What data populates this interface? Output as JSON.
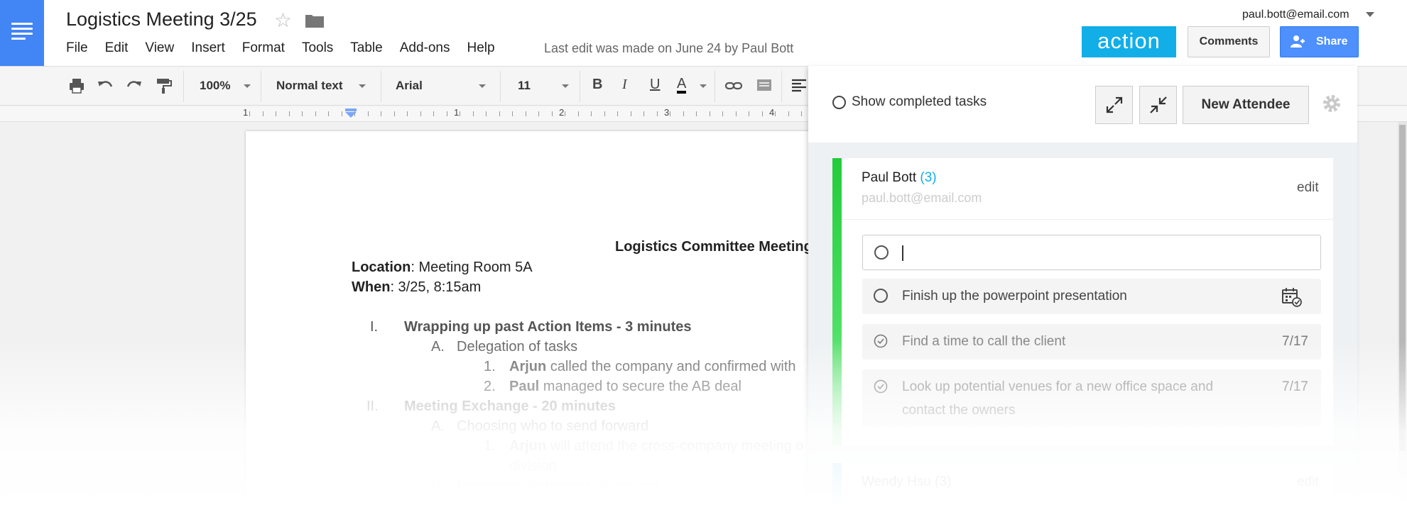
{
  "header": {
    "title": "Logistics Meeting 3/25",
    "menu": [
      "File",
      "Edit",
      "View",
      "Insert",
      "Format",
      "Tools",
      "Table",
      "Add-ons",
      "Help"
    ],
    "last_edit": "Last edit was made on June 24 by Paul Bott",
    "account": "paul.bott@email.com",
    "action_logo": "action",
    "comments_label": "Comments",
    "share_label": "Share"
  },
  "toolbar": {
    "zoom": "100%",
    "style": "Normal text",
    "font": "Arial",
    "size": "11",
    "bold": "B",
    "italic": "I",
    "underline": "U",
    "text_color": "A"
  },
  "ruler": {
    "numbers": [
      "1",
      "1",
      "2",
      "3",
      "4"
    ]
  },
  "document": {
    "heading": "Logistics Committee Meeting",
    "location_label": "Location",
    "location_value": ": Meeting Room 5A",
    "when_label": "When",
    "when_value": ": 3/25, 8:15am",
    "items": [
      {
        "marker": "I.",
        "text": "Wrapping up past Action Items - 3 minutes"
      },
      {
        "marker": "A.",
        "text": "Delegation of tasks"
      },
      {
        "marker": "1.",
        "bold": "Arjun",
        "text": " called the company and confirmed with"
      },
      {
        "marker": "2.",
        "bold": "Paul",
        "text": " managed to secure the AB deal"
      },
      {
        "marker": "II.",
        "text": "Meeting Exchange - 20 minutes"
      },
      {
        "marker": "A.",
        "text": "Choosing who to send forward"
      },
      {
        "marker": "1.",
        "bold": "Arjun",
        "text": " will attend the cross-company meeting o"
      },
      {
        "marker": "",
        "text": "division"
      },
      {
        "marker": "B.",
        "text": "Preparing documents to present"
      }
    ]
  },
  "panel": {
    "show_completed": "Show completed tasks",
    "new_attendee": "New Attendee",
    "attendee": {
      "name": "Paul Bott",
      "count": "(3)",
      "email": "paul.bott@email.com",
      "edit": "edit"
    },
    "tasks": [
      {
        "text": "Finish up the powerpoint presentation",
        "date": "",
        "done": false
      },
      {
        "text": "Find a time to call the client",
        "date": "7/17",
        "done": true
      },
      {
        "text": "Look up potential venues for a new office space and contact the owners",
        "date": "7/17",
        "done": true
      }
    ],
    "attendee2": {
      "name": "Wendy Hsu (3)",
      "edit": "edit"
    }
  },
  "colors": {
    "docs_blue": "#4285f4",
    "action_blue": "#11aee8",
    "share_blue": "#4d90fe",
    "attendee_green": "#22cc3a"
  }
}
